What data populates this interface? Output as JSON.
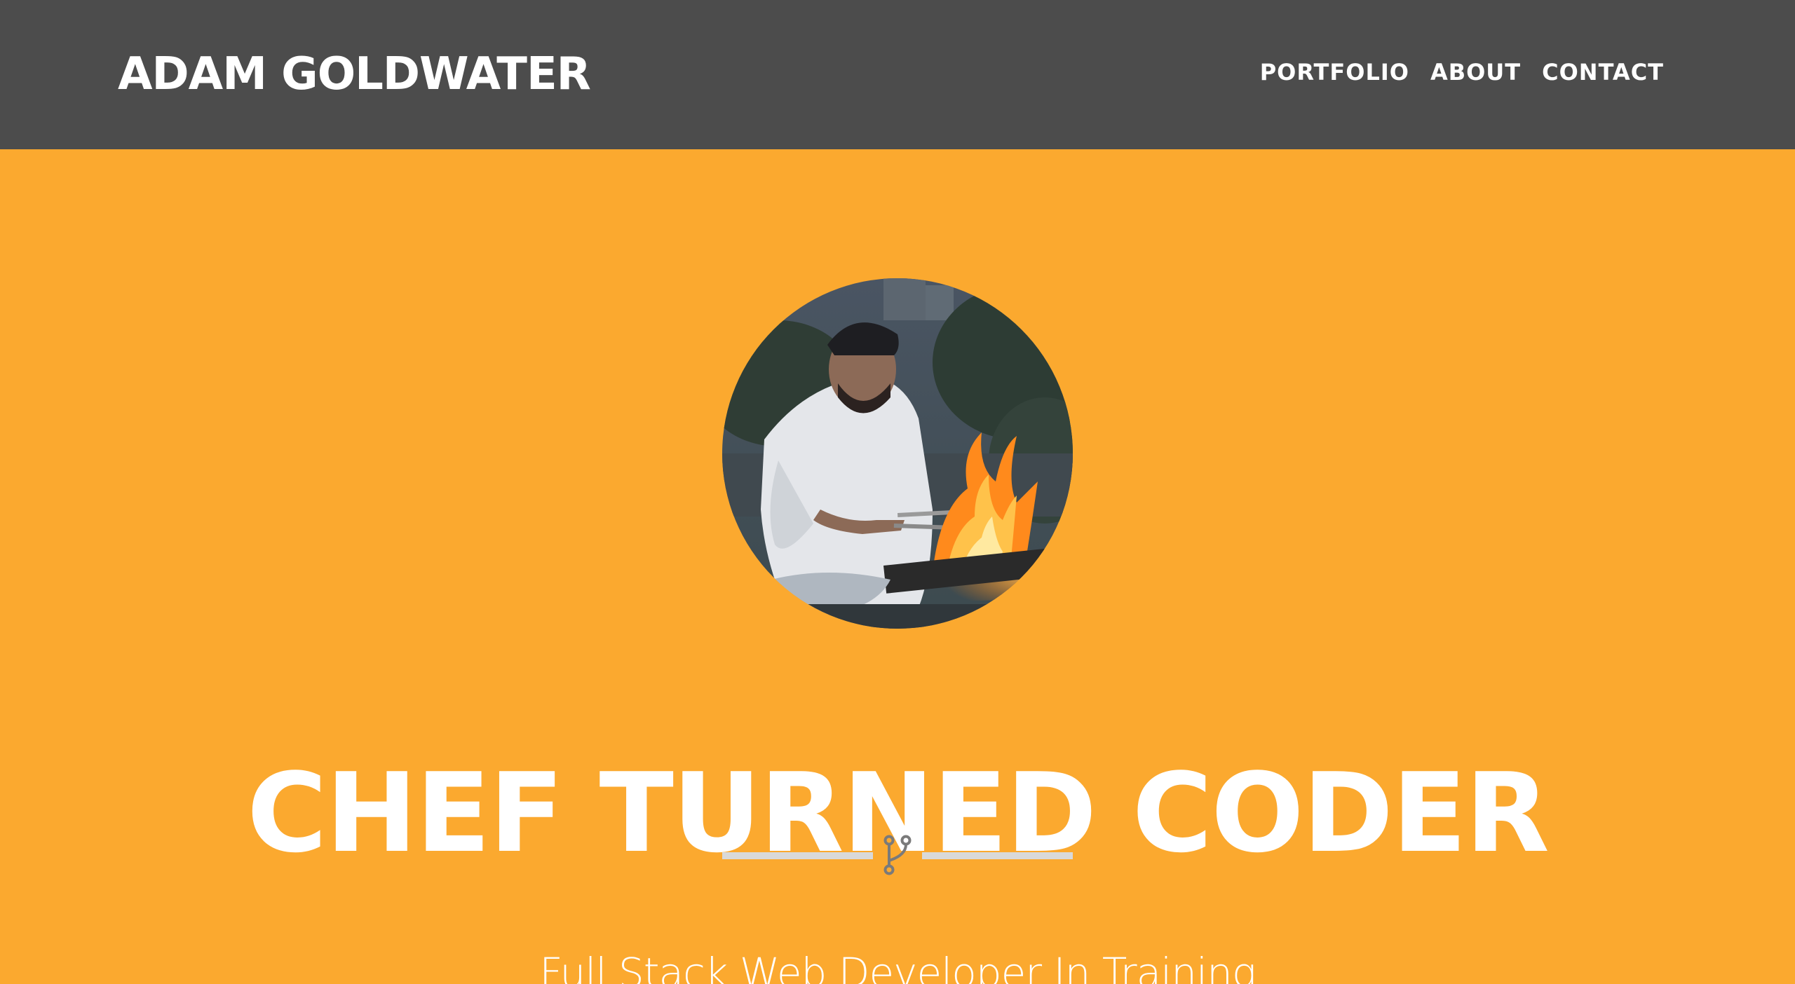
{
  "header": {
    "brand": "ADAM GOLDWATER",
    "nav": [
      {
        "label": "PORTFOLIO"
      },
      {
        "label": "ABOUT"
      },
      {
        "label": "CONTACT"
      }
    ]
  },
  "hero": {
    "avatar_alt": "Chef cooking over flames",
    "headline": "CHEF TURNED CODER",
    "divider_icon": "code-branch-icon",
    "subtitle": "Full Stack Web Developer In Training"
  },
  "colors": {
    "navbar_bg": "#4C4C4C",
    "hero_bg": "#FBA92F",
    "text": "#FFFFFF",
    "divider": "#D9D9D9",
    "divider_icon": "#7A7A7A"
  }
}
